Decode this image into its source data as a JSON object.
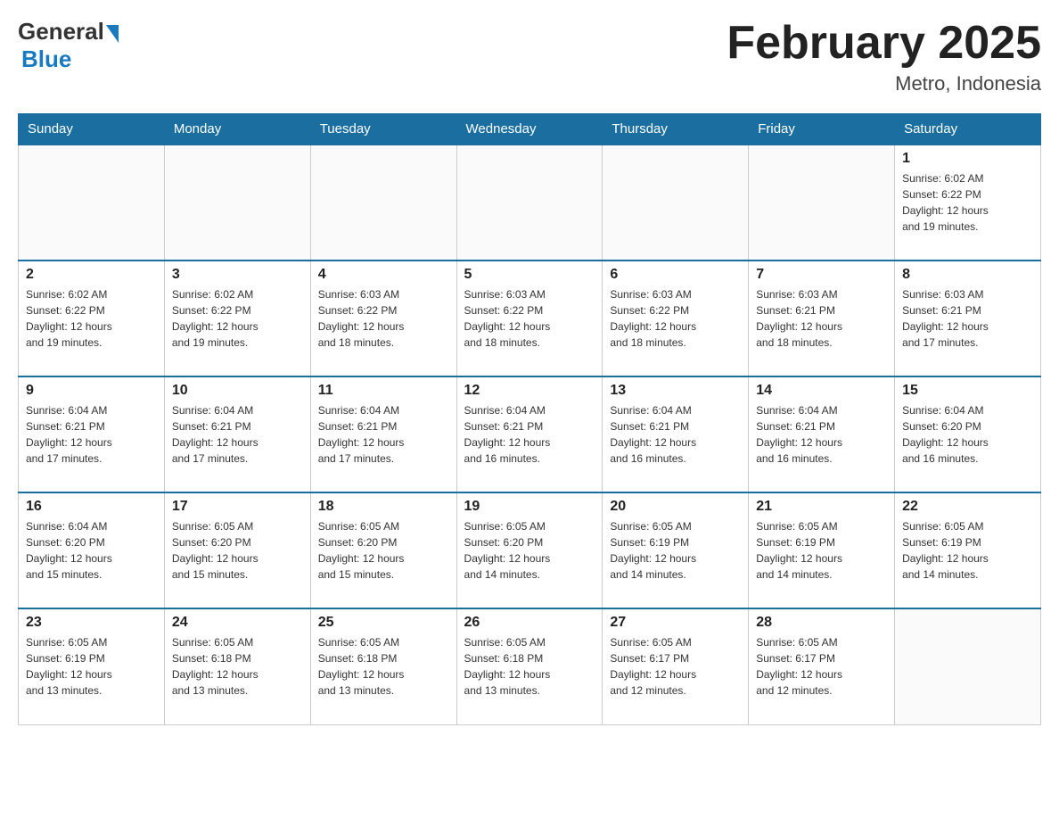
{
  "logo": {
    "general": "General",
    "blue": "Blue",
    "subtitle": "Blue"
  },
  "header": {
    "title": "February 2025",
    "subtitle": "Metro, Indonesia"
  },
  "weekdays": [
    "Sunday",
    "Monday",
    "Tuesday",
    "Wednesday",
    "Thursday",
    "Friday",
    "Saturday"
  ],
  "weeks": [
    [
      {
        "day": "",
        "info": ""
      },
      {
        "day": "",
        "info": ""
      },
      {
        "day": "",
        "info": ""
      },
      {
        "day": "",
        "info": ""
      },
      {
        "day": "",
        "info": ""
      },
      {
        "day": "",
        "info": ""
      },
      {
        "day": "1",
        "info": "Sunrise: 6:02 AM\nSunset: 6:22 PM\nDaylight: 12 hours\nand 19 minutes."
      }
    ],
    [
      {
        "day": "2",
        "info": "Sunrise: 6:02 AM\nSunset: 6:22 PM\nDaylight: 12 hours\nand 19 minutes."
      },
      {
        "day": "3",
        "info": "Sunrise: 6:02 AM\nSunset: 6:22 PM\nDaylight: 12 hours\nand 19 minutes."
      },
      {
        "day": "4",
        "info": "Sunrise: 6:03 AM\nSunset: 6:22 PM\nDaylight: 12 hours\nand 18 minutes."
      },
      {
        "day": "5",
        "info": "Sunrise: 6:03 AM\nSunset: 6:22 PM\nDaylight: 12 hours\nand 18 minutes."
      },
      {
        "day": "6",
        "info": "Sunrise: 6:03 AM\nSunset: 6:22 PM\nDaylight: 12 hours\nand 18 minutes."
      },
      {
        "day": "7",
        "info": "Sunrise: 6:03 AM\nSunset: 6:21 PM\nDaylight: 12 hours\nand 18 minutes."
      },
      {
        "day": "8",
        "info": "Sunrise: 6:03 AM\nSunset: 6:21 PM\nDaylight: 12 hours\nand 17 minutes."
      }
    ],
    [
      {
        "day": "9",
        "info": "Sunrise: 6:04 AM\nSunset: 6:21 PM\nDaylight: 12 hours\nand 17 minutes."
      },
      {
        "day": "10",
        "info": "Sunrise: 6:04 AM\nSunset: 6:21 PM\nDaylight: 12 hours\nand 17 minutes."
      },
      {
        "day": "11",
        "info": "Sunrise: 6:04 AM\nSunset: 6:21 PM\nDaylight: 12 hours\nand 17 minutes."
      },
      {
        "day": "12",
        "info": "Sunrise: 6:04 AM\nSunset: 6:21 PM\nDaylight: 12 hours\nand 16 minutes."
      },
      {
        "day": "13",
        "info": "Sunrise: 6:04 AM\nSunset: 6:21 PM\nDaylight: 12 hours\nand 16 minutes."
      },
      {
        "day": "14",
        "info": "Sunrise: 6:04 AM\nSunset: 6:21 PM\nDaylight: 12 hours\nand 16 minutes."
      },
      {
        "day": "15",
        "info": "Sunrise: 6:04 AM\nSunset: 6:20 PM\nDaylight: 12 hours\nand 16 minutes."
      }
    ],
    [
      {
        "day": "16",
        "info": "Sunrise: 6:04 AM\nSunset: 6:20 PM\nDaylight: 12 hours\nand 15 minutes."
      },
      {
        "day": "17",
        "info": "Sunrise: 6:05 AM\nSunset: 6:20 PM\nDaylight: 12 hours\nand 15 minutes."
      },
      {
        "day": "18",
        "info": "Sunrise: 6:05 AM\nSunset: 6:20 PM\nDaylight: 12 hours\nand 15 minutes."
      },
      {
        "day": "19",
        "info": "Sunrise: 6:05 AM\nSunset: 6:20 PM\nDaylight: 12 hours\nand 14 minutes."
      },
      {
        "day": "20",
        "info": "Sunrise: 6:05 AM\nSunset: 6:19 PM\nDaylight: 12 hours\nand 14 minutes."
      },
      {
        "day": "21",
        "info": "Sunrise: 6:05 AM\nSunset: 6:19 PM\nDaylight: 12 hours\nand 14 minutes."
      },
      {
        "day": "22",
        "info": "Sunrise: 6:05 AM\nSunset: 6:19 PM\nDaylight: 12 hours\nand 14 minutes."
      }
    ],
    [
      {
        "day": "23",
        "info": "Sunrise: 6:05 AM\nSunset: 6:19 PM\nDaylight: 12 hours\nand 13 minutes."
      },
      {
        "day": "24",
        "info": "Sunrise: 6:05 AM\nSunset: 6:18 PM\nDaylight: 12 hours\nand 13 minutes."
      },
      {
        "day": "25",
        "info": "Sunrise: 6:05 AM\nSunset: 6:18 PM\nDaylight: 12 hours\nand 13 minutes."
      },
      {
        "day": "26",
        "info": "Sunrise: 6:05 AM\nSunset: 6:18 PM\nDaylight: 12 hours\nand 13 minutes."
      },
      {
        "day": "27",
        "info": "Sunrise: 6:05 AM\nSunset: 6:17 PM\nDaylight: 12 hours\nand 12 minutes."
      },
      {
        "day": "28",
        "info": "Sunrise: 6:05 AM\nSunset: 6:17 PM\nDaylight: 12 hours\nand 12 minutes."
      },
      {
        "day": "",
        "info": ""
      }
    ]
  ]
}
